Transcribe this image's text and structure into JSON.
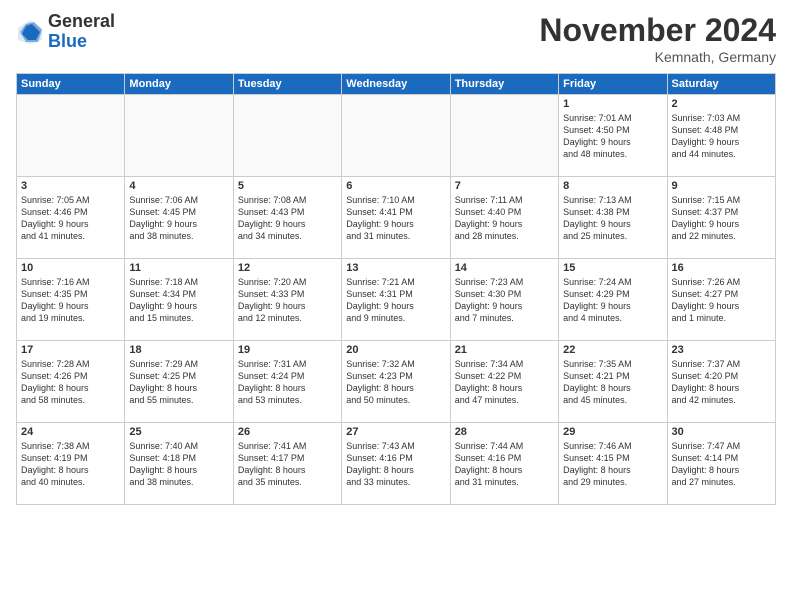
{
  "logo": {
    "general": "General",
    "blue": "Blue"
  },
  "header": {
    "month": "November 2024",
    "location": "Kemnath, Germany"
  },
  "weekdays": [
    "Sunday",
    "Monday",
    "Tuesday",
    "Wednesday",
    "Thursday",
    "Friday",
    "Saturday"
  ],
  "weeks": [
    [
      {
        "day": "",
        "info": ""
      },
      {
        "day": "",
        "info": ""
      },
      {
        "day": "",
        "info": ""
      },
      {
        "day": "",
        "info": ""
      },
      {
        "day": "",
        "info": ""
      },
      {
        "day": "1",
        "info": "Sunrise: 7:01 AM\nSunset: 4:50 PM\nDaylight: 9 hours\nand 48 minutes."
      },
      {
        "day": "2",
        "info": "Sunrise: 7:03 AM\nSunset: 4:48 PM\nDaylight: 9 hours\nand 44 minutes."
      }
    ],
    [
      {
        "day": "3",
        "info": "Sunrise: 7:05 AM\nSunset: 4:46 PM\nDaylight: 9 hours\nand 41 minutes."
      },
      {
        "day": "4",
        "info": "Sunrise: 7:06 AM\nSunset: 4:45 PM\nDaylight: 9 hours\nand 38 minutes."
      },
      {
        "day": "5",
        "info": "Sunrise: 7:08 AM\nSunset: 4:43 PM\nDaylight: 9 hours\nand 34 minutes."
      },
      {
        "day": "6",
        "info": "Sunrise: 7:10 AM\nSunset: 4:41 PM\nDaylight: 9 hours\nand 31 minutes."
      },
      {
        "day": "7",
        "info": "Sunrise: 7:11 AM\nSunset: 4:40 PM\nDaylight: 9 hours\nand 28 minutes."
      },
      {
        "day": "8",
        "info": "Sunrise: 7:13 AM\nSunset: 4:38 PM\nDaylight: 9 hours\nand 25 minutes."
      },
      {
        "day": "9",
        "info": "Sunrise: 7:15 AM\nSunset: 4:37 PM\nDaylight: 9 hours\nand 22 minutes."
      }
    ],
    [
      {
        "day": "10",
        "info": "Sunrise: 7:16 AM\nSunset: 4:35 PM\nDaylight: 9 hours\nand 19 minutes."
      },
      {
        "day": "11",
        "info": "Sunrise: 7:18 AM\nSunset: 4:34 PM\nDaylight: 9 hours\nand 15 minutes."
      },
      {
        "day": "12",
        "info": "Sunrise: 7:20 AM\nSunset: 4:33 PM\nDaylight: 9 hours\nand 12 minutes."
      },
      {
        "day": "13",
        "info": "Sunrise: 7:21 AM\nSunset: 4:31 PM\nDaylight: 9 hours\nand 9 minutes."
      },
      {
        "day": "14",
        "info": "Sunrise: 7:23 AM\nSunset: 4:30 PM\nDaylight: 9 hours\nand 7 minutes."
      },
      {
        "day": "15",
        "info": "Sunrise: 7:24 AM\nSunset: 4:29 PM\nDaylight: 9 hours\nand 4 minutes."
      },
      {
        "day": "16",
        "info": "Sunrise: 7:26 AM\nSunset: 4:27 PM\nDaylight: 9 hours\nand 1 minute."
      }
    ],
    [
      {
        "day": "17",
        "info": "Sunrise: 7:28 AM\nSunset: 4:26 PM\nDaylight: 8 hours\nand 58 minutes."
      },
      {
        "day": "18",
        "info": "Sunrise: 7:29 AM\nSunset: 4:25 PM\nDaylight: 8 hours\nand 55 minutes."
      },
      {
        "day": "19",
        "info": "Sunrise: 7:31 AM\nSunset: 4:24 PM\nDaylight: 8 hours\nand 53 minutes."
      },
      {
        "day": "20",
        "info": "Sunrise: 7:32 AM\nSunset: 4:23 PM\nDaylight: 8 hours\nand 50 minutes."
      },
      {
        "day": "21",
        "info": "Sunrise: 7:34 AM\nSunset: 4:22 PM\nDaylight: 8 hours\nand 47 minutes."
      },
      {
        "day": "22",
        "info": "Sunrise: 7:35 AM\nSunset: 4:21 PM\nDaylight: 8 hours\nand 45 minutes."
      },
      {
        "day": "23",
        "info": "Sunrise: 7:37 AM\nSunset: 4:20 PM\nDaylight: 8 hours\nand 42 minutes."
      }
    ],
    [
      {
        "day": "24",
        "info": "Sunrise: 7:38 AM\nSunset: 4:19 PM\nDaylight: 8 hours\nand 40 minutes."
      },
      {
        "day": "25",
        "info": "Sunrise: 7:40 AM\nSunset: 4:18 PM\nDaylight: 8 hours\nand 38 minutes."
      },
      {
        "day": "26",
        "info": "Sunrise: 7:41 AM\nSunset: 4:17 PM\nDaylight: 8 hours\nand 35 minutes."
      },
      {
        "day": "27",
        "info": "Sunrise: 7:43 AM\nSunset: 4:16 PM\nDaylight: 8 hours\nand 33 minutes."
      },
      {
        "day": "28",
        "info": "Sunrise: 7:44 AM\nSunset: 4:16 PM\nDaylight: 8 hours\nand 31 minutes."
      },
      {
        "day": "29",
        "info": "Sunrise: 7:46 AM\nSunset: 4:15 PM\nDaylight: 8 hours\nand 29 minutes."
      },
      {
        "day": "30",
        "info": "Sunrise: 7:47 AM\nSunset: 4:14 PM\nDaylight: 8 hours\nand 27 minutes."
      }
    ]
  ]
}
